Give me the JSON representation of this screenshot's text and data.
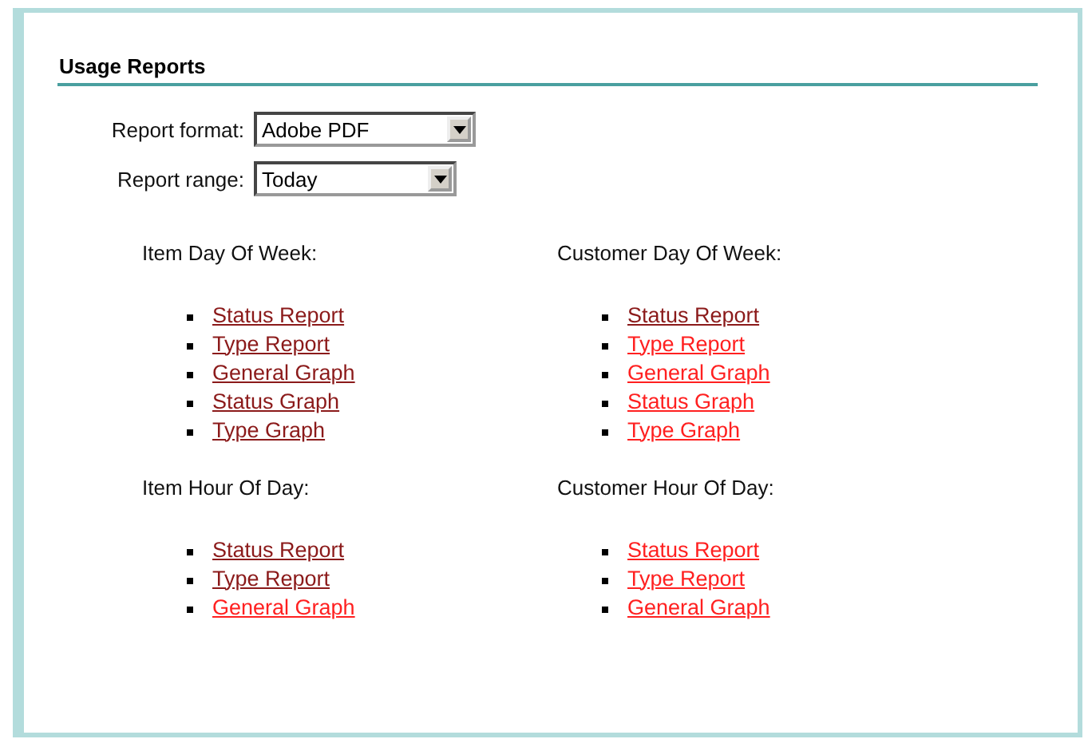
{
  "title": "Usage Reports",
  "fields": [
    {
      "label": "Report format:",
      "value": "Adobe PDF"
    },
    {
      "label": "Report range:",
      "value": "Today"
    }
  ],
  "sections": [
    {
      "heading": "Item Day Of Week:",
      "links": [
        {
          "label": "Status Report",
          "visited": true
        },
        {
          "label": "Type Report",
          "visited": true
        },
        {
          "label": "General Graph",
          "visited": true
        },
        {
          "label": "Status Graph",
          "visited": true
        },
        {
          "label": "Type Graph",
          "visited": true
        }
      ]
    },
    {
      "heading": "Customer Day Of Week:",
      "links": [
        {
          "label": "Status Report",
          "visited": true
        },
        {
          "label": "Type Report",
          "visited": false
        },
        {
          "label": "General Graph",
          "visited": false
        },
        {
          "label": "Status Graph",
          "visited": false
        },
        {
          "label": "Type Graph",
          "visited": false
        }
      ]
    },
    {
      "heading": "Item Hour Of Day:",
      "links": [
        {
          "label": "Status Report",
          "visited": true
        },
        {
          "label": "Type Report",
          "visited": true
        },
        {
          "label": "General Graph",
          "visited": false
        }
      ]
    },
    {
      "heading": "Customer Hour Of Day:",
      "links": [
        {
          "label": "Status Report",
          "visited": false
        },
        {
          "label": "Type Report",
          "visited": false
        },
        {
          "label": "General Graph",
          "visited": false
        }
      ]
    }
  ]
}
